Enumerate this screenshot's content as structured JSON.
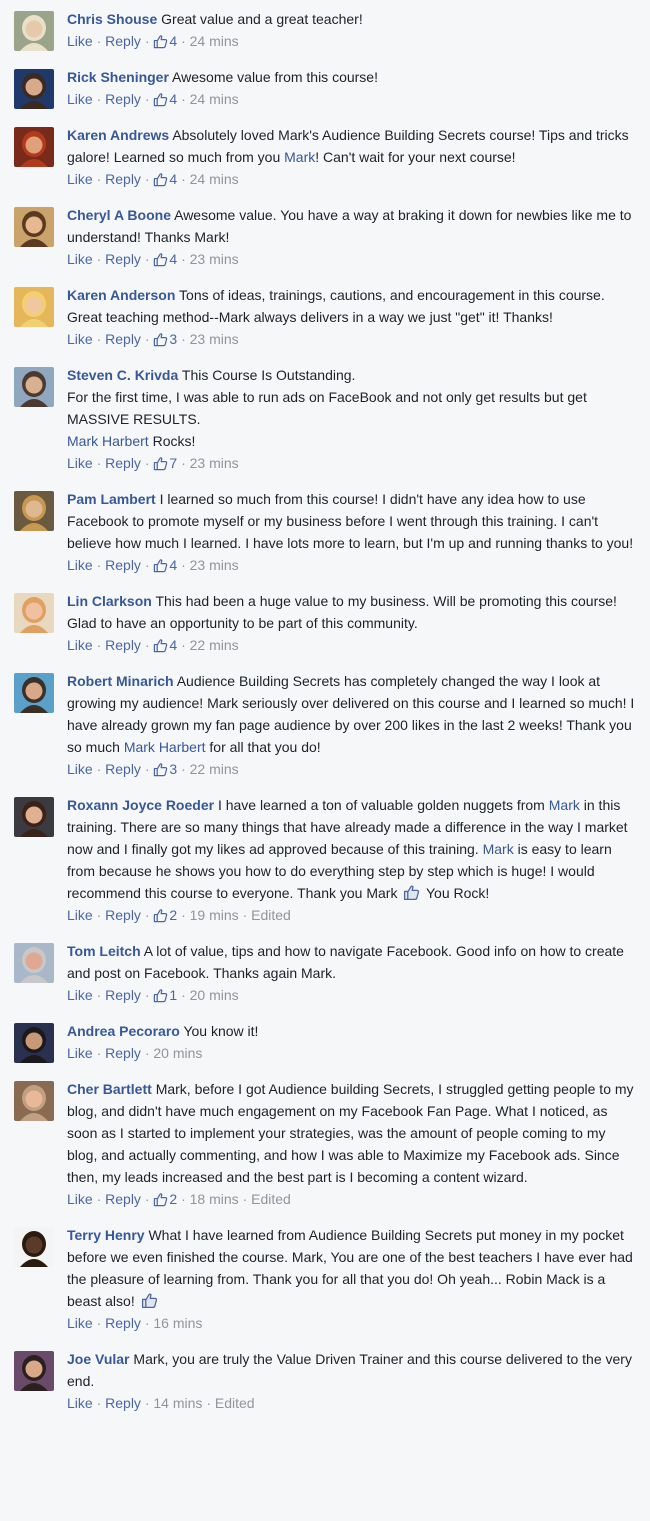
{
  "ui": {
    "like_label": "Like",
    "reply_label": "Reply",
    "sep": "·",
    "edited_label": "Edited"
  },
  "colors": {
    "link": "#365899",
    "meta": "#90949c",
    "bg": "#f6f7f9"
  },
  "comments": [
    {
      "author": "Chris Shouse",
      "segments": [
        {
          "t": "Great value and a great teacher!"
        }
      ],
      "likes": "4",
      "time": "24 mins",
      "edited": false,
      "avatar": {
        "bg": "#9aa48a",
        "fg": "#e6c9a8",
        "hair": "#e8e0c8"
      }
    },
    {
      "author": "Rick Sheninger",
      "segments": [
        {
          "t": "Awesome value from this course!"
        }
      ],
      "likes": "4",
      "time": "24 mins",
      "edited": false,
      "avatar": {
        "bg": "#1f3a6a",
        "fg": "#d8a98a",
        "hair": "#3a2a20"
      }
    },
    {
      "author": "Karen Andrews",
      "segments": [
        {
          "t": "Absolutely loved Mark's Audience Building Secrets course! Tips and tricks galore! Learned so much from you "
        },
        {
          "t": "Mark",
          "m": true
        },
        {
          "t": "! Can't wait for your next course!"
        }
      ],
      "likes": "4",
      "time": "24 mins",
      "edited": false,
      "avatar": {
        "bg": "#7a2a1a",
        "fg": "#e0a07a",
        "hair": "#b03a1a"
      }
    },
    {
      "author": "Cheryl A Boone",
      "segments": [
        {
          "t": "Awesome value. You have a way at braking it down for newbies like me to understand! Thanks Mark!"
        }
      ],
      "likes": "4",
      "time": "23 mins",
      "edited": false,
      "avatar": {
        "bg": "#caa36a",
        "fg": "#e8b890",
        "hair": "#5a3a20"
      }
    },
    {
      "author": "Karen Anderson",
      "segments": [
        {
          "t": "Tons of ideas, trainings, cautions, and encouragement in this course. Great teaching method--Mark always delivers in a way we just \"get\" it! Thanks!"
        }
      ],
      "likes": "3",
      "time": "23 mins",
      "edited": false,
      "avatar": {
        "bg": "#e6b65a",
        "fg": "#f0c8a0",
        "hair": "#f2d070"
      }
    },
    {
      "author": "Steven C. Krivda",
      "segments": [
        {
          "t": "This Course Is Outstanding."
        },
        {
          "br": true
        },
        {
          "t": "For the first time, I was able to run ads on FaceBook and not only get results but get MASSIVE RESULTS."
        },
        {
          "br": true
        },
        {
          "t": "Mark Harbert",
          "m": true
        },
        {
          "t": " Rocks!"
        }
      ],
      "likes": "7",
      "time": "23 mins",
      "edited": false,
      "avatar": {
        "bg": "#8fa8c0",
        "fg": "#d9b090",
        "hair": "#4a3a30"
      }
    },
    {
      "author": "Pam Lambert",
      "segments": [
        {
          "t": "I learned so much from this course! I didn't have any idea how to use Facebook to promote myself or my business before I went through this training. I can't believe how much I learned. I have lots more to learn, but I'm up and running thanks to you!"
        }
      ],
      "likes": "4",
      "time": "23 mins",
      "edited": false,
      "avatar": {
        "bg": "#6a5a40",
        "fg": "#e0b890",
        "hair": "#c89850"
      }
    },
    {
      "author": "Lin Clarkson",
      "segments": [
        {
          "t": "This had been a huge value to my business. Will be promoting this course! Glad to have an opportunity to be part of this community."
        }
      ],
      "likes": "4",
      "time": "22 mins",
      "edited": false,
      "avatar": {
        "bg": "#e8d8c0",
        "fg": "#f0c0a0",
        "hair": "#e0a060"
      }
    },
    {
      "author": "Robert Minarich",
      "segments": [
        {
          "t": "Audience Building Secrets has completely changed the way I look at growing my audience! Mark seriously over delivered on this course and I learned so much! I have already grown my fan page audience by over 200 likes in the last 2 weeks! Thank you so much "
        },
        {
          "t": "Mark Harbert",
          "m": true
        },
        {
          "t": " for all that you do!"
        }
      ],
      "likes": "3",
      "time": "22 mins",
      "edited": false,
      "avatar": {
        "bg": "#5aa0c8",
        "fg": "#d8a888",
        "hair": "#3a3028"
      }
    },
    {
      "author": "Roxann Joyce Roeder",
      "segments": [
        {
          "t": "I have learned a ton of valuable golden nuggets from "
        },
        {
          "t": "Mark",
          "m": true
        },
        {
          "t": " in this training. There are so many things that have already made a difference in the way I market now and I finally got my likes ad approved because of this training. "
        },
        {
          "t": "Mark",
          "m": true
        },
        {
          "t": " is easy to learn from because he shows you how to do everything step by step which is huge! I would recommend this course to everyone. Thank you Mark "
        },
        {
          "icon": "thumbs-up-emoticon"
        },
        {
          "t": " You Rock!"
        }
      ],
      "likes": "2",
      "time": "19 mins",
      "edited": true,
      "avatar": {
        "bg": "#3a3a40",
        "fg": "#e0b090",
        "hair": "#3a2218"
      }
    },
    {
      "author": "Tom Leitch",
      "segments": [
        {
          "t": "A lot of value, tips and how to navigate Facebook. Good info on how to create and post on Facebook. Thanks again Mark."
        }
      ],
      "likes": "1",
      "time": "20 mins",
      "edited": false,
      "avatar": {
        "bg": "#a8b8c8",
        "fg": "#e0a890",
        "hair": "#c8c8c8"
      }
    },
    {
      "author": "Andrea Pecoraro",
      "segments": [
        {
          "t": "You know it!"
        }
      ],
      "likes": "",
      "time": "20 mins",
      "edited": false,
      "avatar": {
        "bg": "#2a3050",
        "fg": "#c89878",
        "hair": "#1a1a1a"
      }
    },
    {
      "author": "Cher Bartlett",
      "segments": [
        {
          "t": "Mark, before I got Audience building Secrets, I struggled getting people to my blog, and didn't have much engagement on my Facebook Fan Page. What I noticed, as soon as I started to implement your strategies, was the amount of people coming to my blog, and actually commenting, and how I was able to Maximize my Facebook ads. Since then, my leads increased and the best part is I becoming a content wizard."
        }
      ],
      "likes": "2",
      "time": "18 mins",
      "edited": true,
      "avatar": {
        "bg": "#8a6a50",
        "fg": "#e8b898",
        "hair": "#c0a080"
      }
    },
    {
      "author": "Terry Henry",
      "segments": [
        {
          "t": "What I have learned from Audience Building Secrets put money in my pocket before we even finished the course. Mark, You are one of the best teachers I have ever had the pleasure of learning from. Thank you for all that you do! Oh yeah... Robin Mack is a beast also! "
        },
        {
          "icon": "thumbs-up-emoticon"
        }
      ],
      "likes": "",
      "time": "16 mins",
      "edited": false,
      "avatar": {
        "bg": "#f4f4f4",
        "fg": "#5a3a28",
        "hair": "#2a1a10"
      }
    },
    {
      "author": "Joe Vular",
      "segments": [
        {
          "t": "Mark, you are truly the Value Driven Trainer and this course delivered to the very end."
        }
      ],
      "likes": "",
      "time": "14 mins",
      "edited": true,
      "avatar": {
        "bg": "#6a4a6a",
        "fg": "#d8a888",
        "hair": "#2a2020"
      }
    }
  ]
}
